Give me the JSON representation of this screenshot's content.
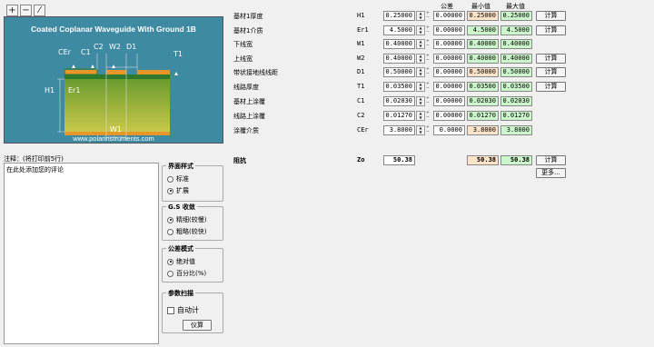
{
  "toolbar": {
    "add": "+",
    "remove": "−",
    "edit": "⁄"
  },
  "diagram": {
    "title": "Coated Coplanar Waveguide With Ground 1B",
    "url": "www.polarinstruments.com",
    "labels": {
      "cer": "CEr",
      "c1": "C1",
      "c2": "C2",
      "w2": "W2",
      "d1": "D1",
      "t1": "T1",
      "h1": "H1",
      "er1": "Er1",
      "w1": "W1"
    }
  },
  "notes": {
    "label": "注释：(将打印前5行)",
    "text": "在此处添加您的评论"
  },
  "groups": {
    "interface": {
      "title": "界面样式",
      "options": [
        "标准",
        "扩展"
      ],
      "selected": 1
    },
    "gs": {
      "title": "G.S 收敛",
      "options": [
        "精细(较慢)",
        "粗略(较快)"
      ],
      "selected": 0
    },
    "tolerance": {
      "title": "公差模式",
      "options": [
        "绝对值",
        "百分比(%)"
      ],
      "selected": 0
    },
    "sweep": {
      "title": "参数扫描",
      "auto_label": "自动计",
      "calc_label": "仪算"
    }
  },
  "headers": {
    "tol": "公差",
    "min": "最小值",
    "max": "最大值"
  },
  "params": [
    {
      "label": "基材1厚度",
      "sym": "H1",
      "val": "0.25000",
      "tol": "0.00000",
      "min": "0.25000",
      "max": "0.25000",
      "minc": "orange",
      "maxc": "green",
      "calc": "计算"
    },
    {
      "label": "基材1介质",
      "sym": "Er1",
      "val": "4.5000",
      "tol": "0.00000",
      "min": "4.5000",
      "max": "4.5000",
      "minc": "green",
      "maxc": "green",
      "calc": "计算"
    },
    {
      "label": "下线宽",
      "sym": "W1",
      "val": "0.40000",
      "tol": "0.00000",
      "min": "0.40000",
      "max": "0.40000",
      "minc": "green",
      "maxc": "green",
      "calc": ""
    },
    {
      "label": "上线宽",
      "sym": "W2",
      "val": "0.40000",
      "tol": "0.00000",
      "min": "0.40000",
      "max": "0.40000",
      "minc": "green",
      "maxc": "green",
      "calc": "计算"
    },
    {
      "label": "带状接地线线距",
      "sym": "D1",
      "val": "0.50000",
      "tol": "0.00000",
      "min": "0.50000",
      "max": "0.50000",
      "minc": "orange",
      "maxc": "green",
      "calc": "计算"
    },
    {
      "label": "线路厚度",
      "sym": "T1",
      "val": "0.03500",
      "tol": "0.00000",
      "min": "0.03500",
      "max": "0.03500",
      "minc": "green",
      "maxc": "green",
      "calc": "计算"
    },
    {
      "label": "基材上涂覆",
      "sym": "C1",
      "val": "0.02030",
      "tol": "0.00000",
      "min": "0.02030",
      "max": "0.02030",
      "minc": "green",
      "maxc": "green",
      "calc": ""
    },
    {
      "label": "线路上涂覆",
      "sym": "C2",
      "val": "0.01270",
      "tol": "0.00000",
      "min": "0.01270",
      "max": "0.01270",
      "minc": "green",
      "maxc": "green",
      "calc": ""
    },
    {
      "label": "涂覆介质",
      "sym": "CEr",
      "val": "3.8000",
      "tol": "0.0000",
      "min": "3.8000",
      "max": "3.8000",
      "minc": "orange",
      "maxc": "green",
      "calc": ""
    }
  ],
  "impedance": {
    "label": "阻抗",
    "sym": "Zo",
    "val": "50.38",
    "min": "50.38",
    "max": "50.38",
    "calc": "计算",
    "more": "更多..."
  }
}
